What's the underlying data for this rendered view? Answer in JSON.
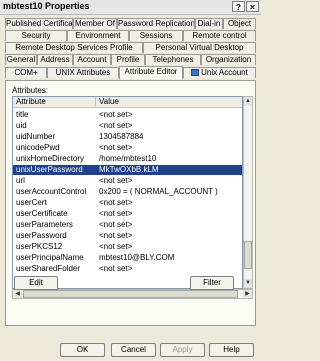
{
  "window": {
    "title": "mbtest10 Properties",
    "help_glyph": "?",
    "close_glyph": "✕"
  },
  "tabs": {
    "row1": [
      "Published Certificates",
      "Member Of",
      "Password Replication",
      "Dial-in",
      "Object"
    ],
    "row2": [
      "Security",
      "Environment",
      "Sessions",
      "Remote control"
    ],
    "row3": [
      "Remote Desktop Services Profile",
      "Personal Virtual Desktop"
    ],
    "row4": [
      "General",
      "Address",
      "Account",
      "Profile",
      "Telephones",
      "Organization"
    ],
    "row5": [
      "COM+",
      "UNIX Attributes",
      "Attribute Editor",
      "Unix Account"
    ],
    "active": "Attribute Editor"
  },
  "attribute_editor": {
    "section_label": "Attributes:",
    "columns": [
      "Attribute",
      "Value"
    ],
    "rows": [
      {
        "attribute": "title",
        "value": "<not set>"
      },
      {
        "attribute": "uid",
        "value": "<not set>"
      },
      {
        "attribute": "uidNumber",
        "value": "1304587884"
      },
      {
        "attribute": "unicodePwd",
        "value": "<not set>"
      },
      {
        "attribute": "unixHomeDirectory",
        "value": "/home/mbtest10"
      },
      {
        "attribute": "unixUserPassword",
        "value": "MkTwOXbB.kLM"
      },
      {
        "attribute": "url",
        "value": "<not set>"
      },
      {
        "attribute": "userAccountControl",
        "value": "0x200 = ( NORMAL_ACCOUNT )"
      },
      {
        "attribute": "userCert",
        "value": "<not set>"
      },
      {
        "attribute": "userCertificate",
        "value": "<not set>"
      },
      {
        "attribute": "userParameters",
        "value": "<not set>"
      },
      {
        "attribute": "userPassword",
        "value": "<not set>"
      },
      {
        "attribute": "userPKCS12",
        "value": "<not set>"
      },
      {
        "attribute": "userPrincipalName",
        "value": "mbtest10@BLY.COM"
      },
      {
        "attribute": "userSharedFolder",
        "value": "<not set>"
      }
    ],
    "selected_attribute": "unixUserPassword",
    "edit_button": "Edit",
    "filter_button": "Filter"
  },
  "footer": {
    "ok": "OK",
    "cancel": "Cancel",
    "apply": "Apply",
    "help": "Help"
  },
  "colors": {
    "selection": "#1f3f8f",
    "dialog_bg": "#ece9d8"
  }
}
